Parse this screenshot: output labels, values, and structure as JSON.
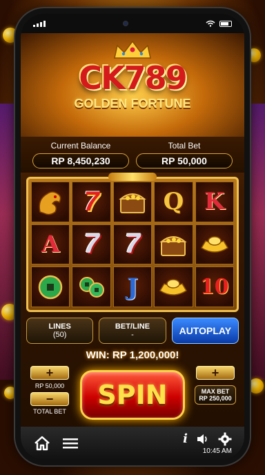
{
  "status": {
    "signal": "signal-icon",
    "wifi": "wifi-icon",
    "battery": "battery-icon"
  },
  "logo": {
    "main": "CK789",
    "sub": "GOLDEN FORTUNE"
  },
  "balance": {
    "label": "Current Balance",
    "value": "RP 8,450,230"
  },
  "total_bet": {
    "label": "Total Bet",
    "value": "RP 50,000"
  },
  "reels": [
    [
      "dragon",
      "red-7",
      "treasure-chest",
      "Q",
      "K"
    ],
    [
      "A",
      "silver-7",
      "silver-7",
      "treasure-chest",
      "gold-ingot"
    ],
    [
      "jade-coin",
      "jade-coins",
      "J",
      "gold-ingot",
      "10"
    ]
  ],
  "reel_text": {
    "r0c1": "7",
    "r0c3": "Q",
    "r0c4": "K",
    "r1c0": "A",
    "r1c1": "7",
    "r1c2": "7",
    "r2c2": "J",
    "r2c4": "10"
  },
  "controls": {
    "lines_label": "LINES",
    "lines_value": "(50)",
    "betline_label": "BET/LINE",
    "betline_value": "-",
    "autoplay": "AUTOPLAY"
  },
  "win": "WIN: RP 1,200,000!",
  "bet": {
    "plus": "+",
    "minus": "−",
    "value": "RP 50,000",
    "total_label": "TOTAL BET",
    "max_label": "MAX BET",
    "max_value": "RP 250,000"
  },
  "spin": "SPIN",
  "nav": {
    "time": "10:45 AM"
  },
  "colors": {
    "gold": "#f0c050",
    "spin_red": "#c00000",
    "autoplay_blue": "#1a5ad8"
  }
}
